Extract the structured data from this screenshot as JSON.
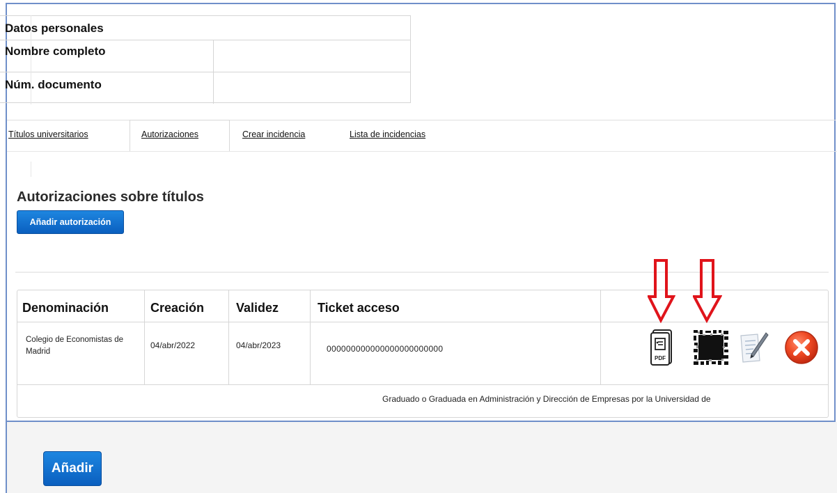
{
  "personal_data": {
    "header": "Datos personales",
    "rows": [
      {
        "label": "Nombre completo",
        "value": ""
      },
      {
        "label": "Núm. documento",
        "value": ""
      }
    ]
  },
  "tabs": [
    {
      "label": "Títulos universitarios"
    },
    {
      "label": "Autorizaciones"
    },
    {
      "label": "Crear incidencia"
    },
    {
      "label": "Lista de incidencias"
    }
  ],
  "section": {
    "title": "Autorizaciones sobre títulos",
    "add_auth_label": "Añadir autorización"
  },
  "table": {
    "headers": [
      "Denominación",
      "Creación",
      "Validez",
      "Ticket acceso"
    ],
    "row": {
      "denominacion": "Colegio de Economistas de Madrid",
      "creacion": "04/abr/2022",
      "validez": "04/abr/2023",
      "ticket": "000000000000000000000000"
    },
    "detail": "Graduado o Graduada en Administración y Dirección de Empresas por la Universidad de"
  },
  "icons": {
    "pdf_label": "PDF"
  },
  "footer": {
    "add_label": "Añadir"
  },
  "colors": {
    "accent": "#0a5fbf",
    "arrow": "#e0141b",
    "frame": "#6f8fc9"
  }
}
